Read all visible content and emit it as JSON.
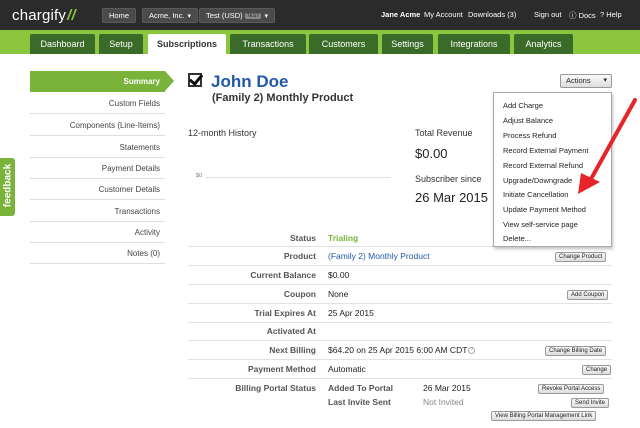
{
  "topbar": {
    "logo": "chargify",
    "home_label": "Home",
    "org_label": "Acme, Inc.",
    "site_label": "Test (USD)",
    "site_badge": "TEST",
    "user_name": "Jane Acme",
    "my_account": "My Account",
    "downloads": "Downloads (3)",
    "sign_out": "Sign out",
    "docs": "Docs",
    "help": "Help"
  },
  "nav": {
    "tabs": [
      "Dashboard",
      "Setup",
      "Subscriptions",
      "Transactions",
      "Customers",
      "Settings",
      "Integrations",
      "Analytics"
    ]
  },
  "sidebar": {
    "items": [
      "Summary",
      "Custom Fields",
      "Components (Line-Items)",
      "Statements",
      "Payment Details",
      "Customer Details",
      "Transactions",
      "Activity",
      "Notes (0)"
    ],
    "feedback": "feedback"
  },
  "header": {
    "customer_name": "John Doe",
    "product": "(Family 2) Monthly Product",
    "actions_label": "Actions"
  },
  "history": {
    "label": "12-month History",
    "axis_tick": "$0"
  },
  "stats": {
    "total_revenue_label": "Total Revenue",
    "total_revenue_value": "$0.00",
    "subscriber_since_label": "Subscriber since",
    "subscriber_since_value": "26 Mar 2015"
  },
  "actions_menu": {
    "items": [
      "Add Charge",
      "Adjust Balance",
      "Process Refund",
      "Record External Payment",
      "Record External Refund",
      "Upgrade/Downgrade",
      "Initiate Cancellation",
      "Update Payment Method",
      "View self-service page",
      "Delete..."
    ]
  },
  "details": {
    "status_label": "Status",
    "status_value": "Trialing",
    "product_label": "Product",
    "product_value": "(Family 2) Monthly Product",
    "product_button": "Change Product",
    "balance_label": "Current Balance",
    "balance_value": "$0.00",
    "coupon_label": "Coupon",
    "coupon_value": "None",
    "coupon_button": "Add Coupon",
    "trial_label": "Trial Expires At",
    "trial_value": "25 Apr 2015",
    "activated_label": "Activated At",
    "activated_value": "",
    "billing_label": "Next Billing",
    "billing_value": "$64.20 on 25 Apr 2015 6:00 AM CDT",
    "billing_button": "Change Billing Date",
    "payment_label": "Payment Method",
    "payment_value": "Automatic",
    "payment_button": "Change",
    "portal_label": "Billing Portal Status",
    "portal_added_label": "Added To Portal",
    "portal_added_value": "26 Mar 2015",
    "portal_revoke_button": "Revoke Portal Access",
    "portal_invite_label": "Last Invite Sent",
    "portal_invite_value": "Not Invited",
    "portal_send_button": "Send Invite",
    "portal_link_button": "View Billing Portal Management Link"
  },
  "colors": {
    "brand_green": "#8cc63f",
    "tab_dark": "#3a6b28",
    "link_blue": "#2358a8",
    "annotation_red": "#e8242b"
  }
}
